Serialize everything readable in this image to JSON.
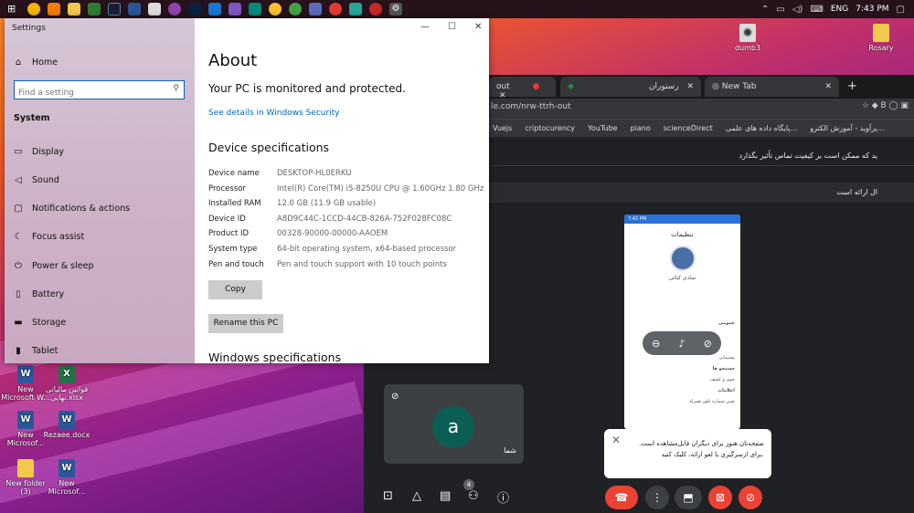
{
  "taskbar": {
    "lang": "ENG",
    "time": "7:43 PM"
  },
  "desktop": {
    "icons_right": [
      {
        "label": "dumb3"
      },
      {
        "label": "Rosary"
      }
    ],
    "icons_left": [
      {
        "label": "New Microsoft W..."
      },
      {
        "label": "قوانین مالیاتی نهایی.xlsx"
      },
      {
        "label": "New Microsof..."
      },
      {
        "label": "Rezaee.docx"
      },
      {
        "label": "New folder (3)"
      },
      {
        "label": "New Microsof..."
      }
    ]
  },
  "browser": {
    "tabs": [
      {
        "label": "out"
      },
      {
        "label": "رستوران"
      },
      {
        "label": "New Tab"
      }
    ],
    "url": "le.com/nrw-ttrh-out",
    "bookmarks": [
      "Vuejs",
      "criptocurency",
      "YouTube",
      "piano",
      "scienceDirect",
      "پایگاه داده های علمی...",
      "پرآوید - آموزش الکترو..."
    ]
  },
  "meet": {
    "banner1": "ید که ممکن است بر کیفیت تماس تأثیر بگذارد",
    "banner2": "ال ارائه است",
    "phone": {
      "status": "7:42 PM",
      "title": "تنظیمات",
      "name": "سادی کبائی",
      "section1": "عمومی",
      "row1": "پشتیبانی",
      "section2": "جستجو ها",
      "row2": "جوی و کشف",
      "section3": "اعلامات",
      "row3": "تغییر شماره تلفن همراه"
    },
    "tile": {
      "initial": "a",
      "name": "شما"
    },
    "participants_count": "4",
    "toast": "صفحه‌تان هنوز برای دیگران قابل‌مشاهده است. برای ازسرگیری یا لغو ارائه، کلیک کنید."
  },
  "settings": {
    "window_title": "Settings",
    "nav": {
      "home": "Home",
      "search_placeholder": "Find a setting",
      "section": "System",
      "items": [
        {
          "label": "Display"
        },
        {
          "label": "Sound"
        },
        {
          "label": "Notifications & actions"
        },
        {
          "label": "Focus assist"
        },
        {
          "label": "Power & sleep"
        },
        {
          "label": "Battery"
        },
        {
          "label": "Storage"
        },
        {
          "label": "Tablet"
        }
      ]
    },
    "about": {
      "title": "About",
      "protection": "Your PC is monitored and protected.",
      "security_link": "See details in Windows Security",
      "device_heading": "Device specifications",
      "specs": [
        {
          "key": "Device name",
          "value": "DESKTOP-HL0ERKU"
        },
        {
          "key": "Processor",
          "value": "Intel(R) Core(TM) i5-8250U CPU @ 1.60GHz   1.80 GHz"
        },
        {
          "key": "Installed RAM",
          "value": "12.0 GB (11.9 GB usable)"
        },
        {
          "key": "Device ID",
          "value": "A8D9C44C-1CCD-44CB-826A-752F028FC08C"
        },
        {
          "key": "Product ID",
          "value": "00328-90000-00000-AAOEM"
        },
        {
          "key": "System type",
          "value": "64-bit operating system, x64-based processor"
        },
        {
          "key": "Pen and touch",
          "value": "Pen and touch support with 10 touch points"
        }
      ],
      "copy_button": "Copy",
      "rename_button": "Rename this PC",
      "windows_heading": "Windows specifications"
    }
  }
}
